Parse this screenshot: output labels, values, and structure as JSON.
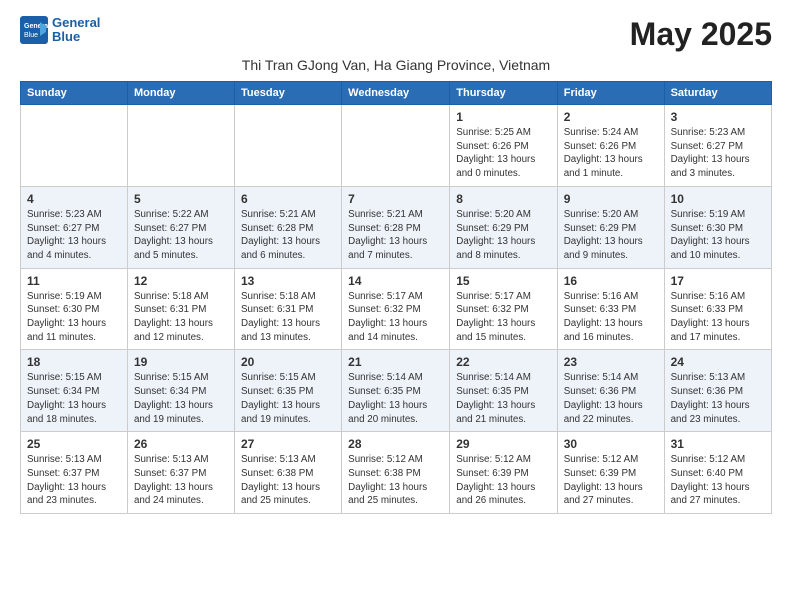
{
  "logo": {
    "line1": "General",
    "line2": "Blue"
  },
  "title": "May 2025",
  "subtitle": "Thi Tran GJong Van, Ha Giang Province, Vietnam",
  "days_of_week": [
    "Sunday",
    "Monday",
    "Tuesday",
    "Wednesday",
    "Thursday",
    "Friday",
    "Saturday"
  ],
  "weeks": [
    [
      {
        "day": "",
        "info": ""
      },
      {
        "day": "",
        "info": ""
      },
      {
        "day": "",
        "info": ""
      },
      {
        "day": "",
        "info": ""
      },
      {
        "day": "1",
        "info": "Sunrise: 5:25 AM\nSunset: 6:26 PM\nDaylight: 13 hours\nand 0 minutes."
      },
      {
        "day": "2",
        "info": "Sunrise: 5:24 AM\nSunset: 6:26 PM\nDaylight: 13 hours\nand 1 minute."
      },
      {
        "day": "3",
        "info": "Sunrise: 5:23 AM\nSunset: 6:27 PM\nDaylight: 13 hours\nand 3 minutes."
      }
    ],
    [
      {
        "day": "4",
        "info": "Sunrise: 5:23 AM\nSunset: 6:27 PM\nDaylight: 13 hours\nand 4 minutes."
      },
      {
        "day": "5",
        "info": "Sunrise: 5:22 AM\nSunset: 6:27 PM\nDaylight: 13 hours\nand 5 minutes."
      },
      {
        "day": "6",
        "info": "Sunrise: 5:21 AM\nSunset: 6:28 PM\nDaylight: 13 hours\nand 6 minutes."
      },
      {
        "day": "7",
        "info": "Sunrise: 5:21 AM\nSunset: 6:28 PM\nDaylight: 13 hours\nand 7 minutes."
      },
      {
        "day": "8",
        "info": "Sunrise: 5:20 AM\nSunset: 6:29 PM\nDaylight: 13 hours\nand 8 minutes."
      },
      {
        "day": "9",
        "info": "Sunrise: 5:20 AM\nSunset: 6:29 PM\nDaylight: 13 hours\nand 9 minutes."
      },
      {
        "day": "10",
        "info": "Sunrise: 5:19 AM\nSunset: 6:30 PM\nDaylight: 13 hours\nand 10 minutes."
      }
    ],
    [
      {
        "day": "11",
        "info": "Sunrise: 5:19 AM\nSunset: 6:30 PM\nDaylight: 13 hours\nand 11 minutes."
      },
      {
        "day": "12",
        "info": "Sunrise: 5:18 AM\nSunset: 6:31 PM\nDaylight: 13 hours\nand 12 minutes."
      },
      {
        "day": "13",
        "info": "Sunrise: 5:18 AM\nSunset: 6:31 PM\nDaylight: 13 hours\nand 13 minutes."
      },
      {
        "day": "14",
        "info": "Sunrise: 5:17 AM\nSunset: 6:32 PM\nDaylight: 13 hours\nand 14 minutes."
      },
      {
        "day": "15",
        "info": "Sunrise: 5:17 AM\nSunset: 6:32 PM\nDaylight: 13 hours\nand 15 minutes."
      },
      {
        "day": "16",
        "info": "Sunrise: 5:16 AM\nSunset: 6:33 PM\nDaylight: 13 hours\nand 16 minutes."
      },
      {
        "day": "17",
        "info": "Sunrise: 5:16 AM\nSunset: 6:33 PM\nDaylight: 13 hours\nand 17 minutes."
      }
    ],
    [
      {
        "day": "18",
        "info": "Sunrise: 5:15 AM\nSunset: 6:34 PM\nDaylight: 13 hours\nand 18 minutes."
      },
      {
        "day": "19",
        "info": "Sunrise: 5:15 AM\nSunset: 6:34 PM\nDaylight: 13 hours\nand 19 minutes."
      },
      {
        "day": "20",
        "info": "Sunrise: 5:15 AM\nSunset: 6:35 PM\nDaylight: 13 hours\nand 19 minutes."
      },
      {
        "day": "21",
        "info": "Sunrise: 5:14 AM\nSunset: 6:35 PM\nDaylight: 13 hours\nand 20 minutes."
      },
      {
        "day": "22",
        "info": "Sunrise: 5:14 AM\nSunset: 6:35 PM\nDaylight: 13 hours\nand 21 minutes."
      },
      {
        "day": "23",
        "info": "Sunrise: 5:14 AM\nSunset: 6:36 PM\nDaylight: 13 hours\nand 22 minutes."
      },
      {
        "day": "24",
        "info": "Sunrise: 5:13 AM\nSunset: 6:36 PM\nDaylight: 13 hours\nand 23 minutes."
      }
    ],
    [
      {
        "day": "25",
        "info": "Sunrise: 5:13 AM\nSunset: 6:37 PM\nDaylight: 13 hours\nand 23 minutes."
      },
      {
        "day": "26",
        "info": "Sunrise: 5:13 AM\nSunset: 6:37 PM\nDaylight: 13 hours\nand 24 minutes."
      },
      {
        "day": "27",
        "info": "Sunrise: 5:13 AM\nSunset: 6:38 PM\nDaylight: 13 hours\nand 25 minutes."
      },
      {
        "day": "28",
        "info": "Sunrise: 5:12 AM\nSunset: 6:38 PM\nDaylight: 13 hours\nand 25 minutes."
      },
      {
        "day": "29",
        "info": "Sunrise: 5:12 AM\nSunset: 6:39 PM\nDaylight: 13 hours\nand 26 minutes."
      },
      {
        "day": "30",
        "info": "Sunrise: 5:12 AM\nSunset: 6:39 PM\nDaylight: 13 hours\nand 27 minutes."
      },
      {
        "day": "31",
        "info": "Sunrise: 5:12 AM\nSunset: 6:40 PM\nDaylight: 13 hours\nand 27 minutes."
      }
    ]
  ]
}
